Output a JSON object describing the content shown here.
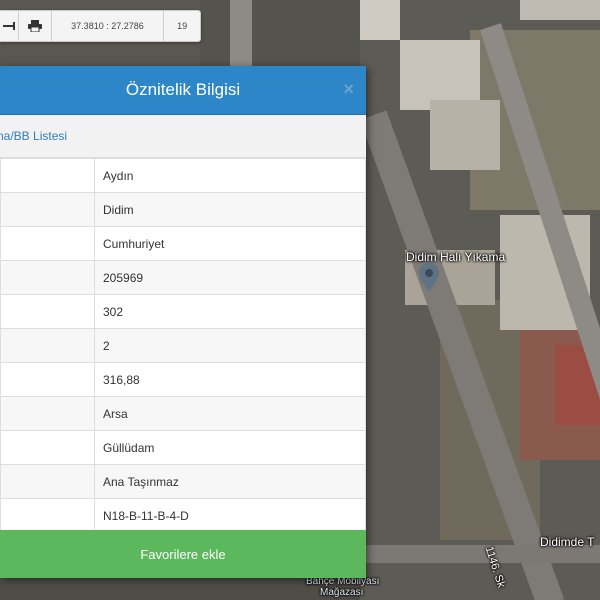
{
  "toolbar": {
    "coordinates": "37.3810 : 27.2786",
    "zoom_level": "19",
    "measure_icon": "ruler-icon",
    "print_icon": "printer-icon"
  },
  "dialog": {
    "title": "Öznitelik Bilgisi",
    "close_label": "×",
    "list_link": "na/BB Listesi",
    "rows": [
      {
        "value": "Aydın"
      },
      {
        "value": "Didim"
      },
      {
        "value": "Cumhuriyet"
      },
      {
        "value": "205969"
      },
      {
        "value": "302"
      },
      {
        "value": "2"
      },
      {
        "value": "316,88"
      },
      {
        "value": "Arsa"
      },
      {
        "value": "Güllüdam"
      },
      {
        "value": "Ana Taşınmaz"
      },
      {
        "value": "N18-B-11-B-4-D"
      }
    ],
    "favorite_button": "Favorilere ekle"
  },
  "map_labels": {
    "poi": "Didim Halı Yıkama",
    "street": "1146. Sk",
    "bottom_right": "Didimde T",
    "shop_line1": "Bahçe Mobilyası",
    "shop_line2": "Mağazası"
  },
  "colors": {
    "header_blue": "#2d86c8",
    "button_green": "#5cb85c",
    "link_blue": "#2d7fc0"
  }
}
